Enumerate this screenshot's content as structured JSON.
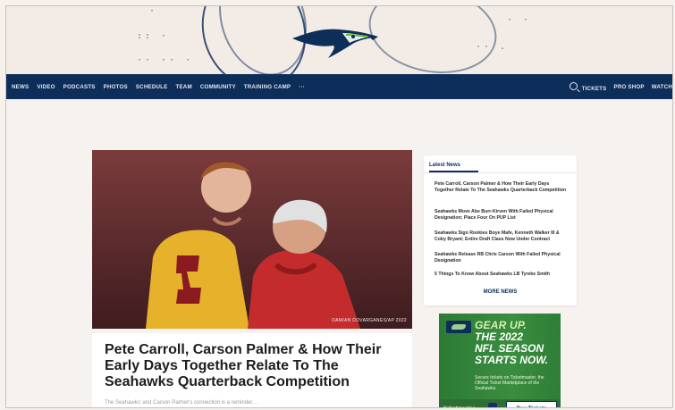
{
  "colors": {
    "navy": "#0e2e5a",
    "green": "#9bd08a",
    "ad_bg": "#2f7a36"
  },
  "brand": {
    "logo_name": "seahawks-logo"
  },
  "nav": {
    "items": [
      "NEWS",
      "VIDEO",
      "PODCASTS",
      "PHOTOS",
      "SCHEDULE",
      "TEAM",
      "COMMUNITY",
      "TRAINING CAMP",
      "···"
    ],
    "right": {
      "tickets": "TICKETS",
      "pro_shop": "PRO SHOP",
      "watch": "WATCH"
    }
  },
  "hero": {
    "credit": "DAMIAN DOVARGANES/AP 2022"
  },
  "story": {
    "headline": "Pete Carroll, Carson Palmer & How Their Early Days Together Relate To The Seahawks Quarterback Competition",
    "blurb": "The Seahawks' and Carson Palmer's connection is a reminder..."
  },
  "latest": {
    "tab": "Latest News",
    "items": [
      "Pete Carroll, Carson Palmer & How Their Early Days Together Relate To The Seahawks Quarterback Competition",
      "Seahawks Move Abe Burr-Kirven With Failed Physical Designation; Place Four On PUP List",
      "Seahawks Sign Rookies Boye Mafe, Kenneth Walker III & Coby Bryant; Entire Draft Class Now Under Contract",
      "Seahawks Release RB Chris Carson With Failed Physical Designation",
      "5 Things To Know About Seahawks LB Tyreke Smith"
    ],
    "more": "MORE NEWS"
  },
  "ad": {
    "line1": "GEAR UP.",
    "line2": "THE 2022",
    "line3": "NFL SEASON",
    "line4": "STARTS NOW.",
    "small": "Secure tickets on Ticketmaster, the Official Ticket Marketplace of the Seahawks.",
    "brand": "ticketmaster",
    "button": "Buy Tickets"
  }
}
